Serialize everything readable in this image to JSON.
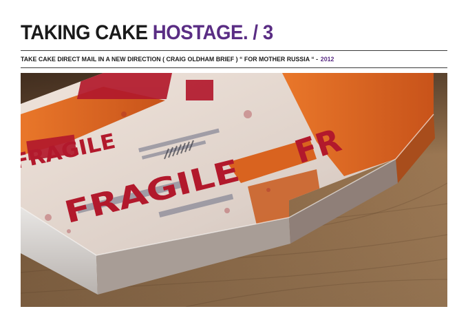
{
  "header": {
    "title_part1": "TAKING CAKE",
    "title_part2": "HOSTAGE. / 3",
    "subtitle": "TAKE CAKE DIRECT MAIL IN A NEW DIRECTION ( CRAIG OLDHAM BRIEF ) “ FOR MOTHER RUSSIA “ -",
    "year": "2012"
  },
  "photo": {
    "printed_words": [
      "FRAGILE",
      "FRAGILE",
      "FR"
    ]
  },
  "colors": {
    "accent": "#5a2d84",
    "text": "#1a1a1a",
    "tape_red": "#b2192c",
    "tape_orange": "#e0691e",
    "wood": "#8a6a4a"
  }
}
